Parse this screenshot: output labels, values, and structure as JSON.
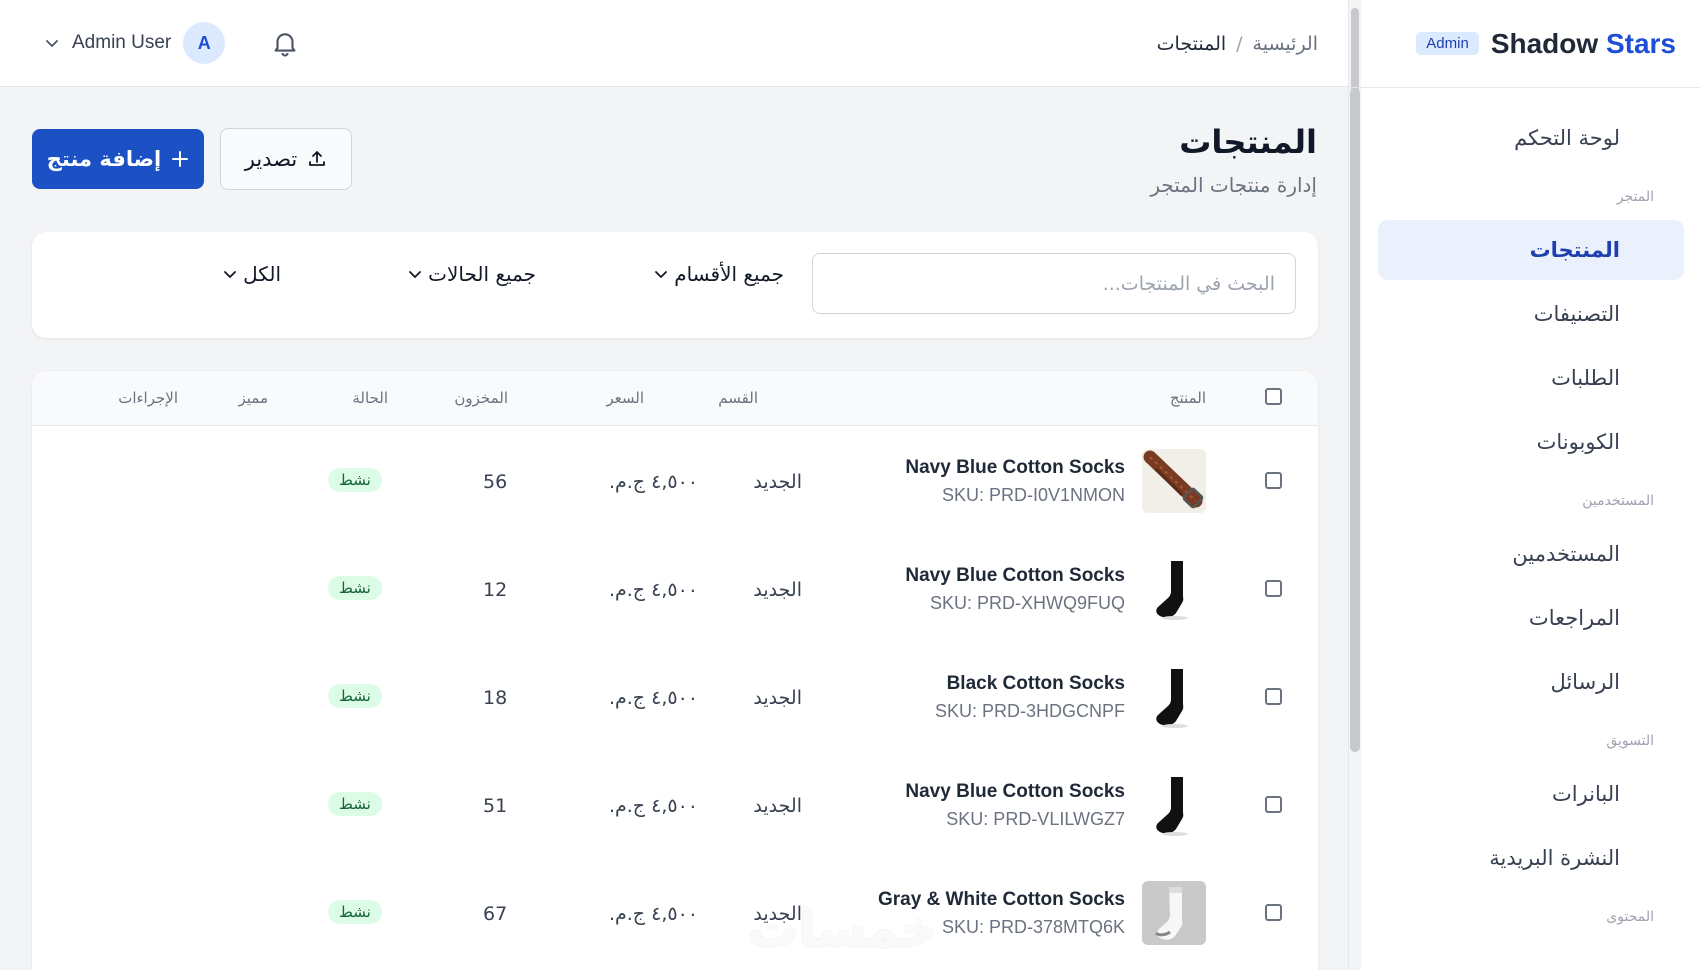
{
  "brand": {
    "name_part1": "Shadow",
    "name_part2": "Stars",
    "badge": "Admin"
  },
  "sidebar": {
    "items": [
      {
        "label": "لوحة التحكم",
        "icon": "home-icon"
      },
      {
        "section": "المتجر"
      },
      {
        "label": "المنتجات",
        "icon": "cube-icon",
        "active": true
      },
      {
        "label": "التصنيفات",
        "icon": "layers-icon"
      },
      {
        "label": "الطلبات",
        "icon": "clipboard-icon"
      },
      {
        "label": "الكوبونات",
        "icon": "tag-icon"
      },
      {
        "section": "المستخدمين"
      },
      {
        "label": "المستخدمين",
        "icon": "users-icon"
      },
      {
        "label": "المراجعات",
        "icon": "star-icon"
      },
      {
        "label": "الرسائل",
        "icon": "mail-icon"
      },
      {
        "section": "التسويق"
      },
      {
        "label": "البانرات",
        "icon": "image-icon"
      },
      {
        "label": "النشرة البريدية",
        "icon": "mail-icon"
      },
      {
        "section": "المحتوى"
      }
    ]
  },
  "header": {
    "breadcrumb": {
      "home": "الرئيسية",
      "separator": "/",
      "current": "المنتجات"
    },
    "user_name": "Admin User",
    "avatar_letter": "A"
  },
  "page": {
    "title": "المنتجات",
    "subtitle": "إدارة منتجات المتجر",
    "add_button": "إضافة منتج",
    "export_button": "تصدير"
  },
  "filters": {
    "search_placeholder": "البحث في المنتجات...",
    "category": "جميع الأقسام",
    "status": "جميع الحالات",
    "featured": "الكل"
  },
  "table": {
    "headers": {
      "product": "المنتج",
      "category": "القسم",
      "price": "السعر",
      "stock": "المخزون",
      "status": "الحالة",
      "featured": "مميز",
      "actions": "الإجراءات"
    },
    "rows": [
      {
        "name": "Navy Blue Cotton Socks",
        "sku": "SKU: PRD-I0V1NMON",
        "category": "الجديد",
        "price": "٤,٥٠٠ ج.م.",
        "stock": "56",
        "status": "نشط",
        "featured": true,
        "thumb": "belt"
      },
      {
        "name": "Navy Blue Cotton Socks",
        "sku": "SKU: PRD-XHWQ9FUQ",
        "category": "الجديد",
        "price": "٤,٥٠٠ ج.م.",
        "stock": "12",
        "status": "نشط",
        "featured": false,
        "thumb": "black-sock"
      },
      {
        "name": "Black Cotton Socks",
        "sku": "SKU: PRD-3HDGCNPF",
        "category": "الجديد",
        "price": "٤,٥٠٠ ج.م.",
        "stock": "18",
        "status": "نشط",
        "featured": false,
        "thumb": "black-sock"
      },
      {
        "name": "Navy Blue Cotton Socks",
        "sku": "SKU: PRD-VLILWGZ7",
        "category": "الجديد",
        "price": "٤,٥٠٠ ج.م.",
        "stock": "51",
        "status": "نشط",
        "featured": true,
        "thumb": "black-sock"
      },
      {
        "name": "Gray & White Cotton Socks",
        "sku": "SKU: PRD-378MTQ6K",
        "category": "الجديد",
        "price": "٤,٥٠٠ ج.م.",
        "stock": "67",
        "status": "نشط",
        "featured": true,
        "thumb": "white-sock"
      }
    ]
  },
  "watermark": "خمسات",
  "colors": {
    "primary": "#1b51c4",
    "active_bg": "#eaf1fd",
    "star": "#f5b800",
    "delete": "#dc2626",
    "edit": "#2563eb",
    "badge_bg": "#dcfce7",
    "badge_text": "#166534"
  }
}
